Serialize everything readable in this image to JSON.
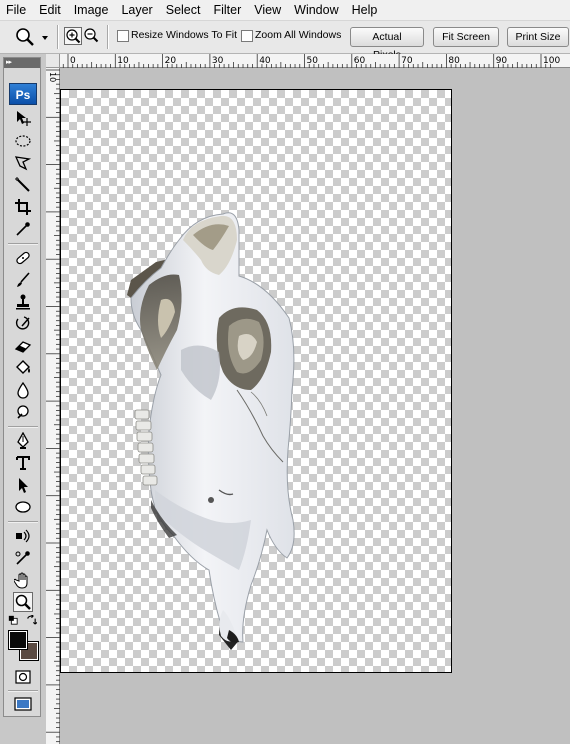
{
  "app": {
    "name": "Photoshop",
    "logo_text": "Ps"
  },
  "menubar": {
    "items": [
      "File",
      "Edit",
      "Image",
      "Layer",
      "Select",
      "Filter",
      "View",
      "Window",
      "Help"
    ]
  },
  "options": {
    "resize_windows_label": "Resize Windows To Fit",
    "resize_windows_checked": false,
    "zoom_all_label": "Zoom All Windows",
    "zoom_all_checked": false,
    "actual_pixels_label": "Actual Pixels",
    "fit_screen_label": "Fit Screen",
    "print_size_label": "Print Size"
  },
  "ruler": {
    "h_ticks": [
      "10",
      "0",
      "10",
      "20",
      "30",
      "40",
      "50",
      "60",
      "70",
      "80",
      "90",
      "100"
    ],
    "v_ticks": [
      "10"
    ]
  },
  "tools": [
    "move-tool",
    "marquee-tool",
    "lasso-tool",
    "magic-wand-tool",
    "crop-tool",
    "eyedropper-tool",
    "healing-brush-tool",
    "brush-tool",
    "clone-stamp-tool",
    "history-brush-tool",
    "eraser-tool",
    "paint-bucket-tool",
    "blur-tool",
    "dodge-tool",
    "pen-tool",
    "type-tool",
    "path-selection-tool",
    "shape-tool",
    "3d-rotate-tool",
    "3d-orbit-tool",
    "hand-tool",
    "zoom-tool"
  ],
  "active_tool": "zoom-tool",
  "colors": {
    "foreground": "#0a0a0a",
    "background": "#5a4a42",
    "workspace": "#c0c0c0",
    "ps_blue": "#0b4fa8"
  },
  "document": {
    "subject": "animal-skull-image",
    "transparent_background": true
  }
}
